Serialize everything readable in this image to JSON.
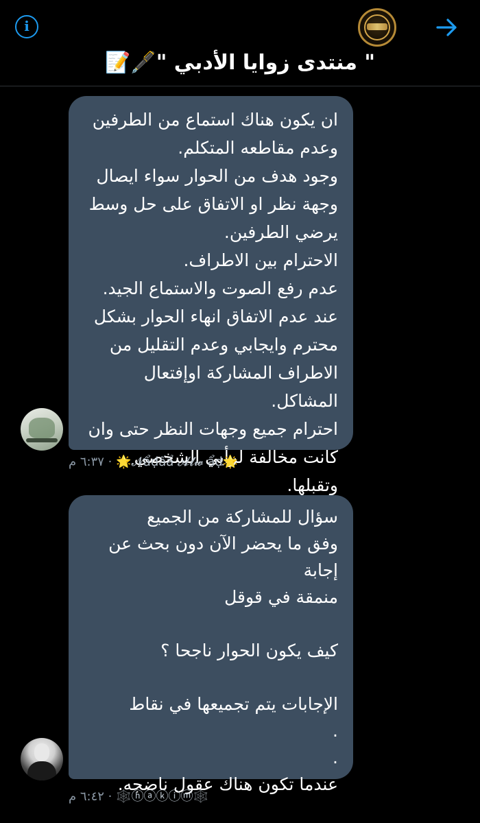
{
  "header": {
    "title": "\" منتدى زوايا الأدبي \"🖋️📝",
    "info_icon_glyph": "i"
  },
  "messages": [
    {
      "text": "ان يكون هناك استماع من الطرفين\nوعدم مقاطعه المتكلم.\nوجود هدف من الحوار سواء ايصال\nوجهة نظر او الاتفاق على حل وسط\nيرضي الطرفين.\nالاحترام بين الاطراف.\nعدم رفع الصوت والاستماع الجيد.\nعند عدم الاتفاق انهاء الحوار بشكل\nمحترم وايجابي وعدم التقليل من\nالاطراف المشاركة اوإفتعال المشاكل.\nاحترام جميع وجهات النظر حتى وان\nكانت مخالفة لرأيي الشخصي وتقبلها.",
      "sender": "🌟𝓝ẩḍấẩ 𝓐𝓵𝔀 ẩḍ🌟",
      "time": "٦:٣٧ م"
    },
    {
      "text": "سؤال للمشاركة من الجميع\nوفق ما يحضر الآن دون بحث عن إجابة\nمنمقة في قوقل\n\nكيف يكون الحوار ناجحا ؟\n\nالإجابات يتم تجميعها في نقاط\n.\n.\nعندما تكون هناك عقول ناضجه.",
      "sender": "🕸️ⓗⓐⓚⓘⓜ🕸️",
      "time": "٦:٤٢ م"
    }
  ],
  "colors": {
    "background": "#000000",
    "bubble": "#3d4e60",
    "accent": "#1d9bf0",
    "meta": "#8b98a5"
  },
  "icons": {
    "info": "info-icon",
    "back": "arrow-right-icon",
    "group_avatar": "group-avatar"
  }
}
